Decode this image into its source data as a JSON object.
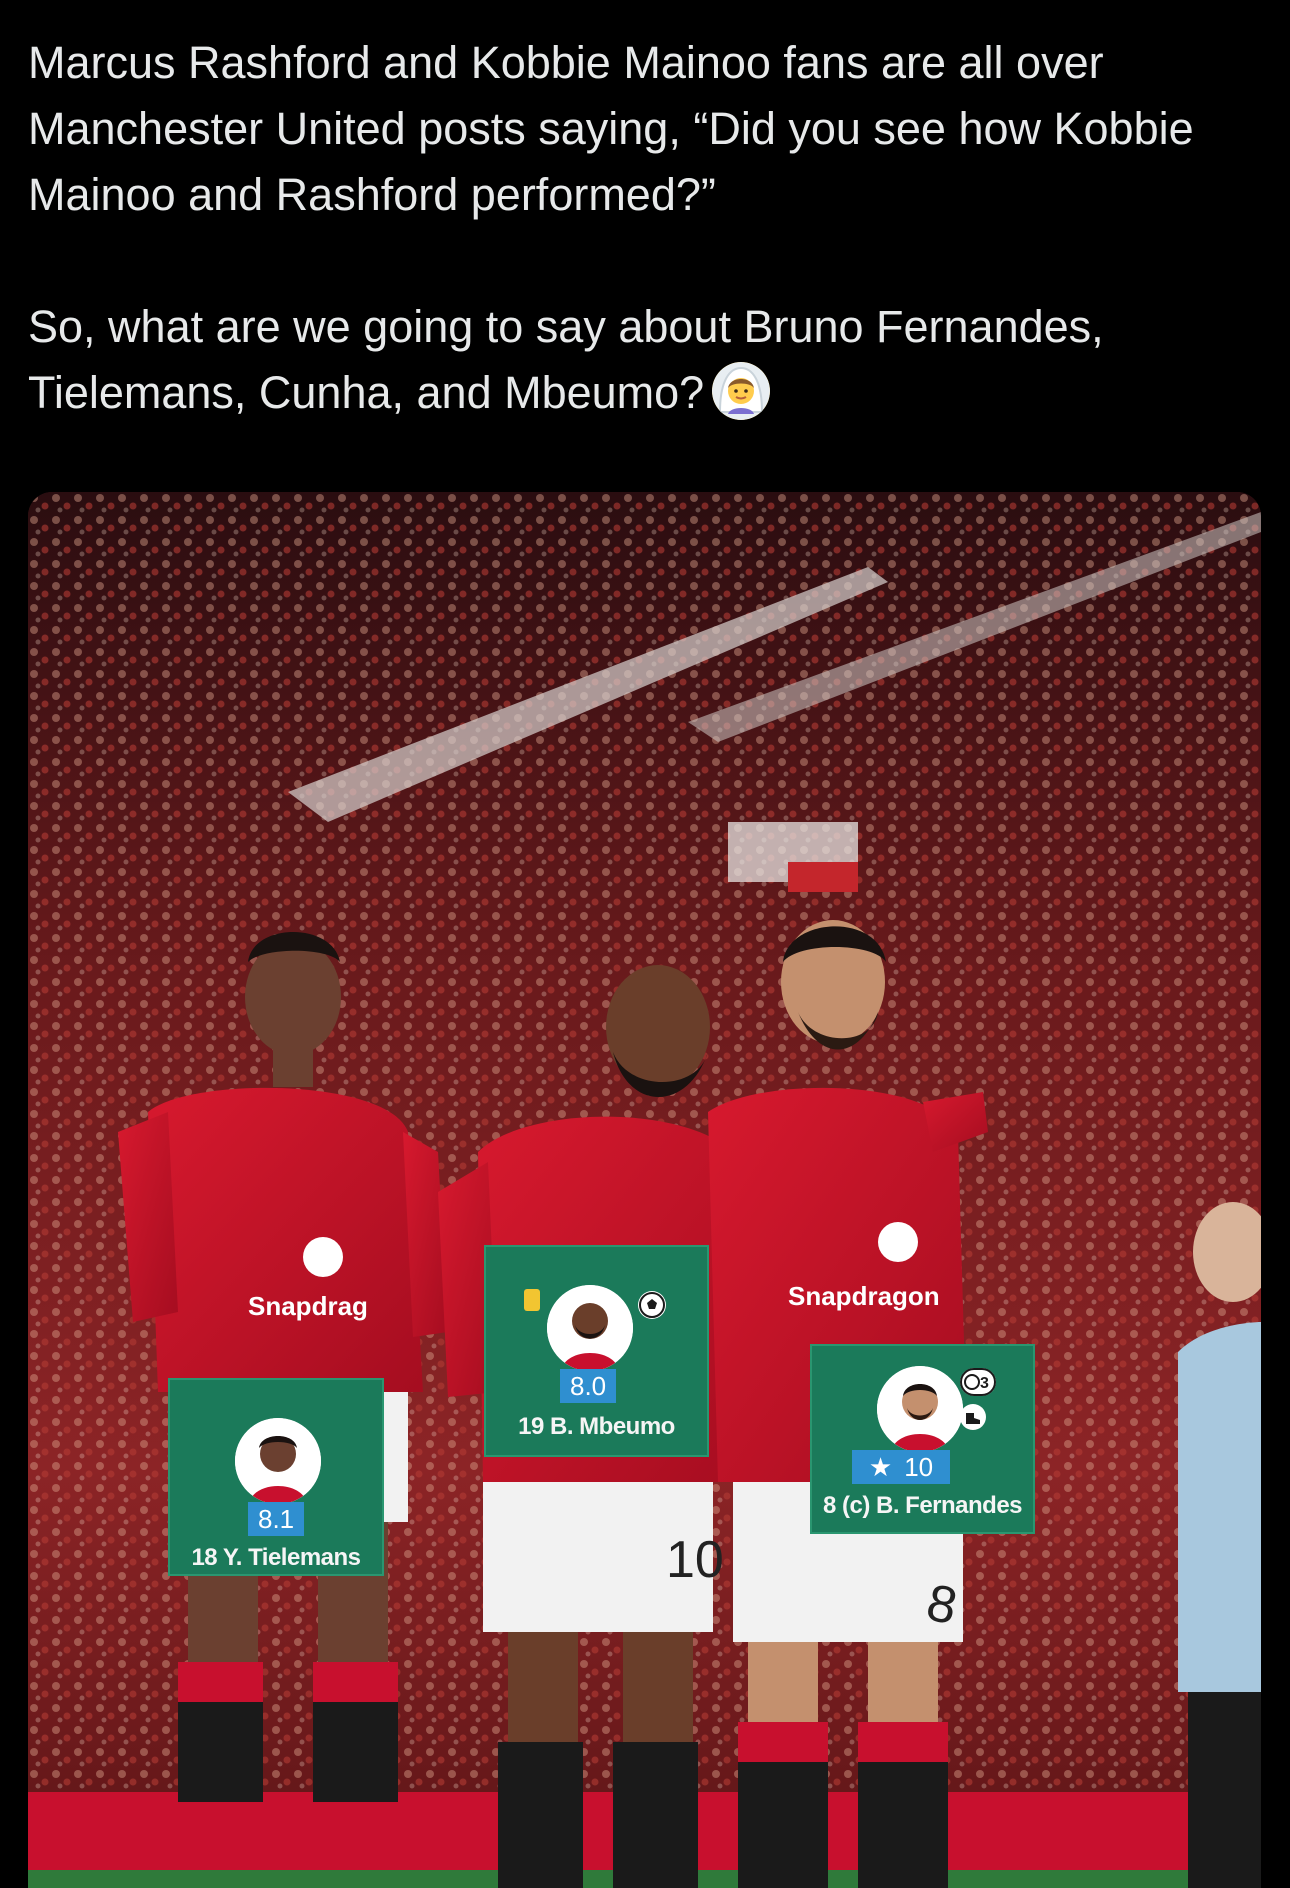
{
  "post": {
    "paragraph_1": "Marcus Rashford and Kobbie Mainoo fans are all over Manchester United posts saying, “Did you see how Kobbie Mainoo and Rashford performed?”",
    "paragraph_2": "So, what are we going to say about Bruno Fernandes, Tielemans, Cunha, and Mbeumo?",
    "emoji": "person-with-veil-emoji"
  },
  "photo": {
    "jersey_sponsor_left": "Snapdrag",
    "jersey_sponsor_right": "Snapdragon",
    "shorts_number_middle": "10",
    "shorts_number_right": "8",
    "colors": {
      "crowd_red": "#8c1c1e",
      "kit_red": "#c8102e",
      "card_green": "#1b7a5a",
      "score_blue": "#2f8fd0"
    }
  },
  "rating_cards": [
    {
      "player": "18 Y. Tielemans",
      "rating": "8.1",
      "icons": []
    },
    {
      "player": "19 B. Mbeumo",
      "rating": "8.0",
      "icons": [
        "yellow-card-icon",
        "goal-ball-icon"
      ]
    },
    {
      "player": "8 (c) B. Fernandes",
      "rating": "10",
      "rating_prefix": "★",
      "icons": [
        "assist-count-icon",
        "assist-boot-icon"
      ],
      "assist_count": "3"
    }
  ]
}
